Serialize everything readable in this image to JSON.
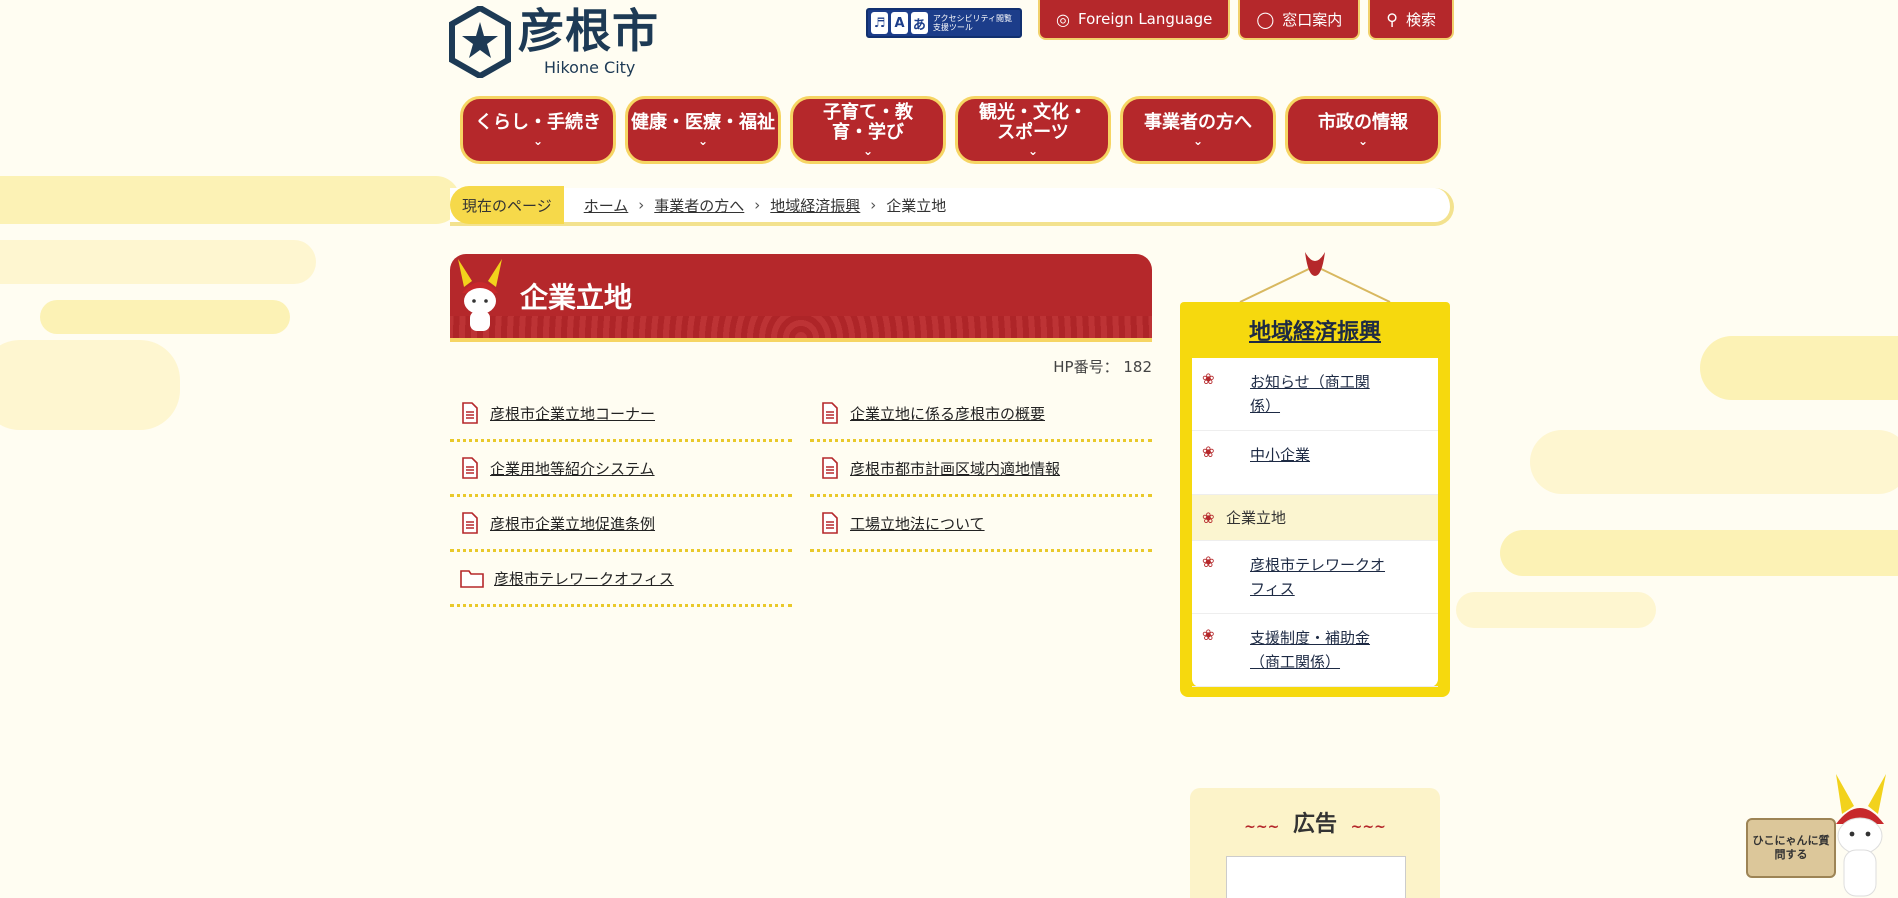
{
  "header": {
    "logo_ja": "彦根市",
    "logo_en": "Hikone City",
    "a11y_label": "アクセシビリティ閲覧支援ツール",
    "tools": [
      {
        "label": "Foreign Language",
        "icon": "globe-icon"
      },
      {
        "label": "窓口案内",
        "icon": "person-icon"
      },
      {
        "label": "検索",
        "icon": "search-icon"
      }
    ]
  },
  "nav": [
    {
      "label": "くらし・手続き"
    },
    {
      "label": "健康・医療・福祉"
    },
    {
      "label": "子育て・教育・学び"
    },
    {
      "label": "観光・文化・スポーツ"
    },
    {
      "label": "事業者の方へ"
    },
    {
      "label": "市政の情報"
    }
  ],
  "breadcrumb": {
    "label": "現在のページ",
    "items": [
      "ホーム",
      "事業者の方へ",
      "地域経済振興"
    ],
    "current": "企業立地"
  },
  "main": {
    "title": "企業立地",
    "hp_number": "HP番号： 182",
    "links": [
      {
        "label": "彦根市企業立地コーナー",
        "icon": "document-icon"
      },
      {
        "label": "企業立地に係る彦根市の概要",
        "icon": "document-icon"
      },
      {
        "label": "企業用地等紹介システム",
        "icon": "document-icon"
      },
      {
        "label": "彦根市都市計画区域内適地情報",
        "icon": "document-icon"
      },
      {
        "label": "彦根市企業立地促進条例",
        "icon": "document-icon"
      },
      {
        "label": "工場立地法について",
        "icon": "document-icon"
      },
      {
        "label": "彦根市テレワークオフィス",
        "icon": "folder-icon"
      }
    ]
  },
  "side": {
    "title": "地域経済振興",
    "items": [
      {
        "label": "お知らせ（商工関係）",
        "current": false
      },
      {
        "label": "中小企業",
        "current": false
      },
      {
        "label": "企業立地",
        "current": true
      },
      {
        "label": "彦根市テレワークオフィス",
        "current": false
      },
      {
        "label": "支援制度・補助金（商工関係）",
        "current": false
      }
    ]
  },
  "ad": {
    "title": "広告"
  },
  "ask": {
    "label": "ひこにゃんに質問する"
  },
  "colors": {
    "brand_red": "#b5282b",
    "accent_yellow": "#f6d90e",
    "navy": "#1d3a55"
  }
}
